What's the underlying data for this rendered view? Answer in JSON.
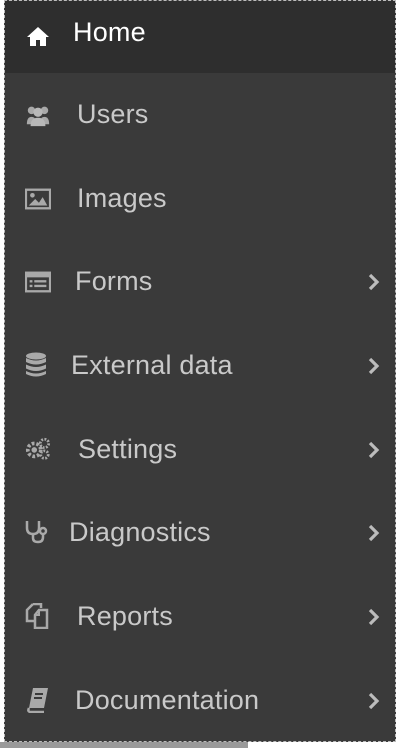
{
  "sidebar": {
    "items": [
      {
        "label": "Home",
        "icon": "home-icon",
        "active": true,
        "has_submenu": false
      },
      {
        "label": "Users",
        "icon": "users-icon",
        "active": false,
        "has_submenu": false
      },
      {
        "label": "Images",
        "icon": "image-icon",
        "active": false,
        "has_submenu": false
      },
      {
        "label": "Forms",
        "icon": "form-icon",
        "active": false,
        "has_submenu": true
      },
      {
        "label": "External data",
        "icon": "database-icon",
        "active": false,
        "has_submenu": true
      },
      {
        "label": "Settings",
        "icon": "cogs-icon",
        "active": false,
        "has_submenu": true
      },
      {
        "label": "Diagnostics",
        "icon": "stethoscope-icon",
        "active": false,
        "has_submenu": true
      },
      {
        "label": "Reports",
        "icon": "copy-icon",
        "active": false,
        "has_submenu": true
      },
      {
        "label": "Documentation",
        "icon": "book-icon",
        "active": false,
        "has_submenu": true
      }
    ]
  },
  "colors": {
    "sidebar_bg": "#3a3a3a",
    "active_bg": "#2e2e2e",
    "text": "#c9c9c9",
    "active_text": "#ffffff"
  }
}
